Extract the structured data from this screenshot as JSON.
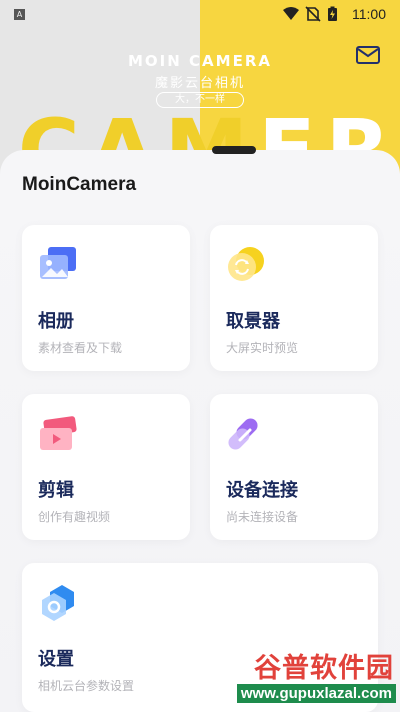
{
  "status_bar": {
    "notification_badge": "A",
    "time": "11:00",
    "icons": [
      "wifi-icon",
      "no-sim-icon",
      "battery-charging-icon"
    ]
  },
  "hero": {
    "title": "MOIN CAMERA",
    "subtitle": "魔影云台相机",
    "slogan": "大，不一样",
    "background_text_left": "CAM",
    "background_text_right": "ERA",
    "mail_icon": "mail-icon",
    "colors": {
      "accent_yellow": "#f7d640",
      "left_gray": "#e6e6e6"
    }
  },
  "main": {
    "app_name": "MoinCamera",
    "cards": [
      {
        "id": "album",
        "title": "相册",
        "subtitle": "素材查看及下载",
        "icon": "album-icon"
      },
      {
        "id": "viewfinder",
        "title": "取景器",
        "subtitle": "大屏实时预览",
        "icon": "viewfinder-icon"
      },
      {
        "id": "edit",
        "title": "剪辑",
        "subtitle": "创作有趣视频",
        "icon": "edit-video-icon"
      },
      {
        "id": "connect",
        "title": "设备连接",
        "subtitle": "尚未连接设备",
        "icon": "link-icon"
      },
      {
        "id": "settings",
        "title": "设置",
        "subtitle": "相机云台参数设置",
        "icon": "settings-icon"
      }
    ]
  },
  "watermark": {
    "top": "谷普软件园",
    "bottom": "www.gupuxlazal.com"
  }
}
